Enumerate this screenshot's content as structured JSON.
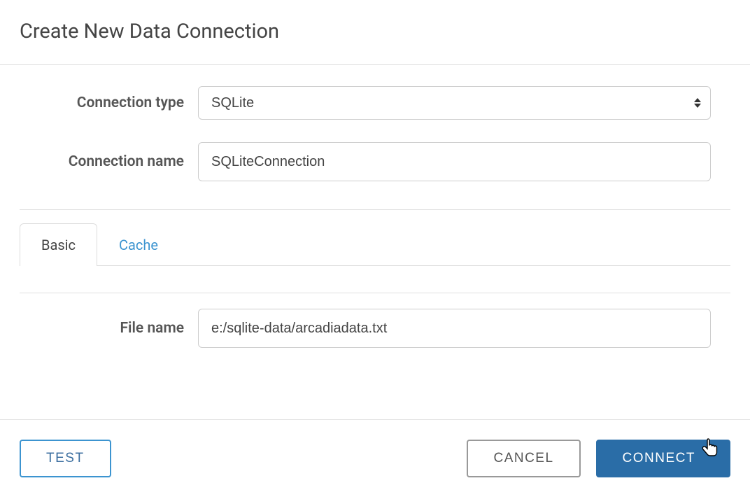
{
  "dialog": {
    "title": "Create New Data Connection"
  },
  "form": {
    "connection_type": {
      "label": "Connection type",
      "value": "SQLite"
    },
    "connection_name": {
      "label": "Connection name",
      "value": "SQLiteConnection"
    },
    "file_name": {
      "label": "File name",
      "value": "e:/sqlite-data/arcadiadata.txt"
    }
  },
  "tabs": {
    "basic": "Basic",
    "cache": "Cache"
  },
  "footer": {
    "test": "TEST",
    "cancel": "CANCEL",
    "connect": "CONNECT"
  }
}
